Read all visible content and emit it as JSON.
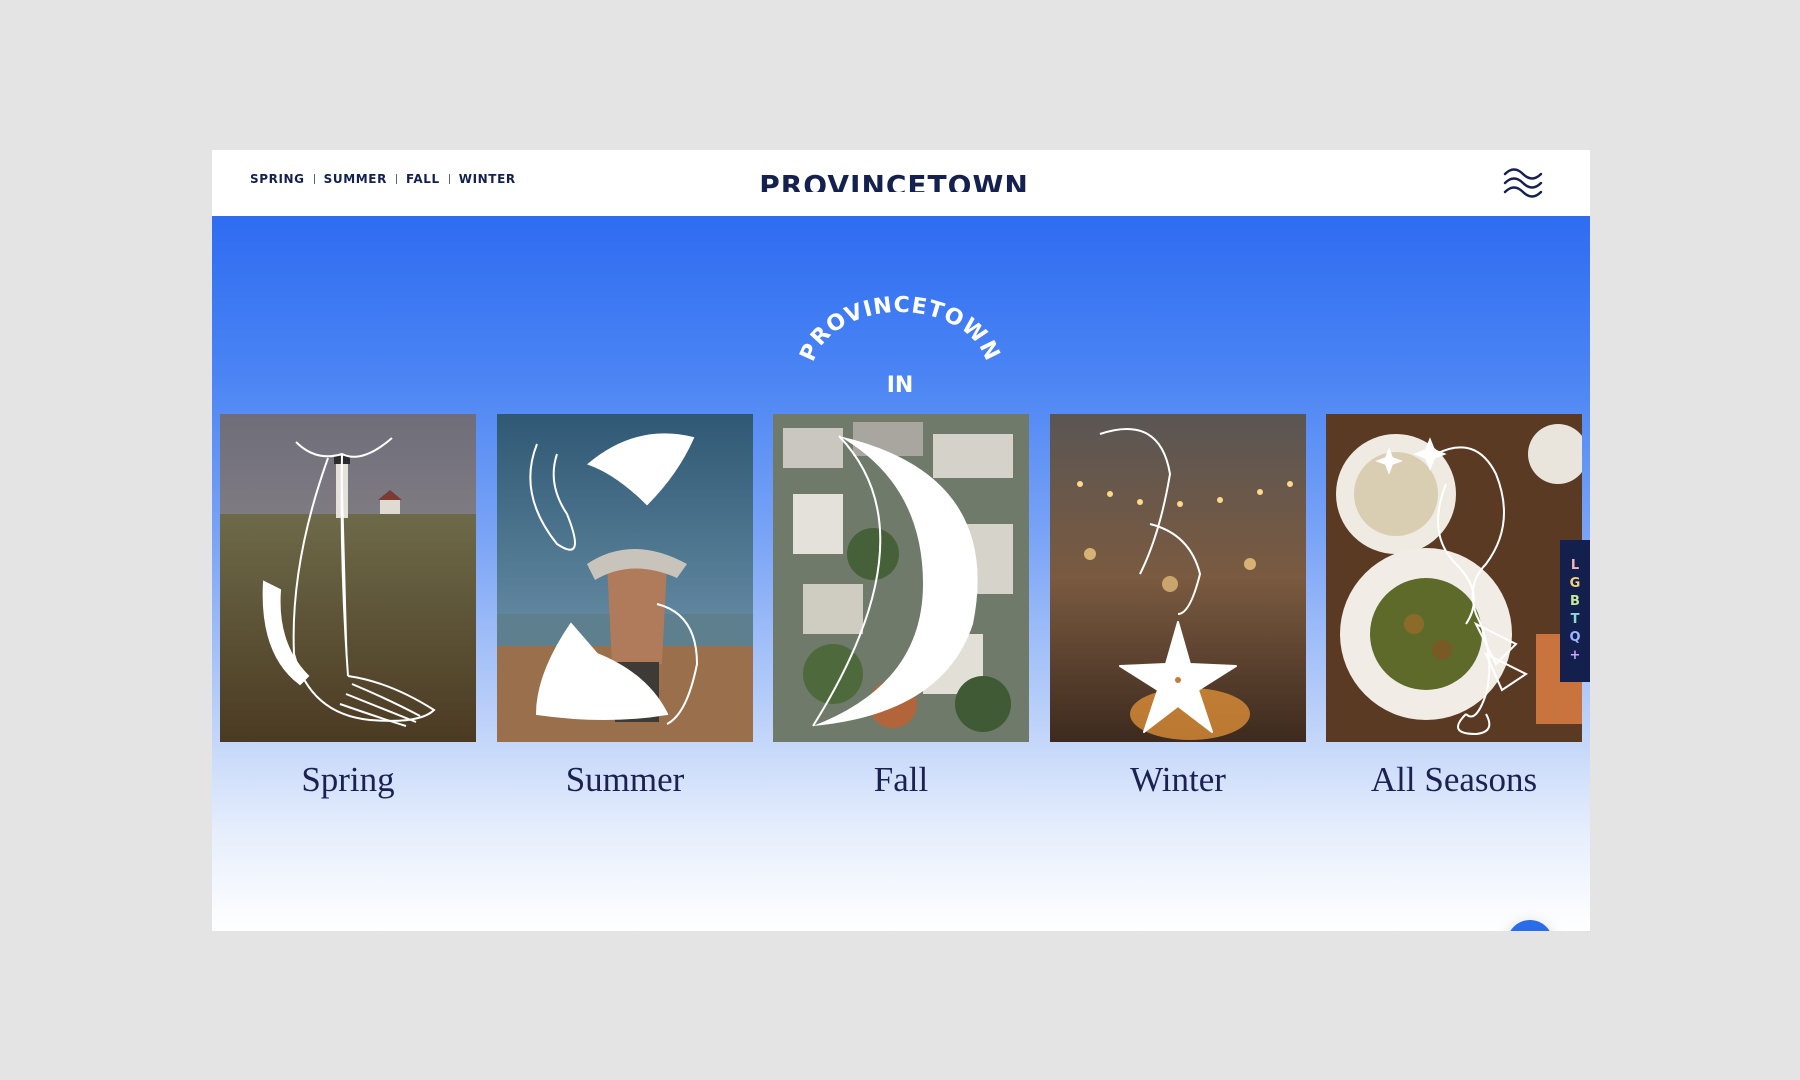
{
  "header": {
    "nav": [
      {
        "label": "SPRING"
      },
      {
        "label": "SUMMER"
      },
      {
        "label": "FALL"
      },
      {
        "label": "WINTER"
      }
    ],
    "brand": "PROVINCETOWN",
    "menu_icon": "waves-menu-icon"
  },
  "hero": {
    "arc_title": "PROVINCETOWN",
    "arc_subtitle": "IN",
    "cards": [
      {
        "label": "Spring",
        "illustration": "whale-icon"
      },
      {
        "label": "Summer",
        "illustration": "mermaids-icon"
      },
      {
        "label": "Fall",
        "illustration": "crescent-moon-icon"
      },
      {
        "label": "Winter",
        "illustration": "starfish-icon"
      },
      {
        "label": "All Seasons",
        "illustration": "lobster-icon"
      }
    ]
  },
  "side_tab": {
    "letters": [
      "L",
      "G",
      "B",
      "T",
      "Q",
      "+"
    ],
    "colors": [
      "#f2b8b8",
      "#f3d27a",
      "#c8e89a",
      "#8fd8d8",
      "#9fb6ff",
      "#c9a6ff"
    ]
  },
  "scroll_top_icon": "chevron-up-icon",
  "colors": {
    "navy": "#14214f",
    "accent_blue": "#2e6cf1",
    "button_blue": "#2b6de9"
  }
}
